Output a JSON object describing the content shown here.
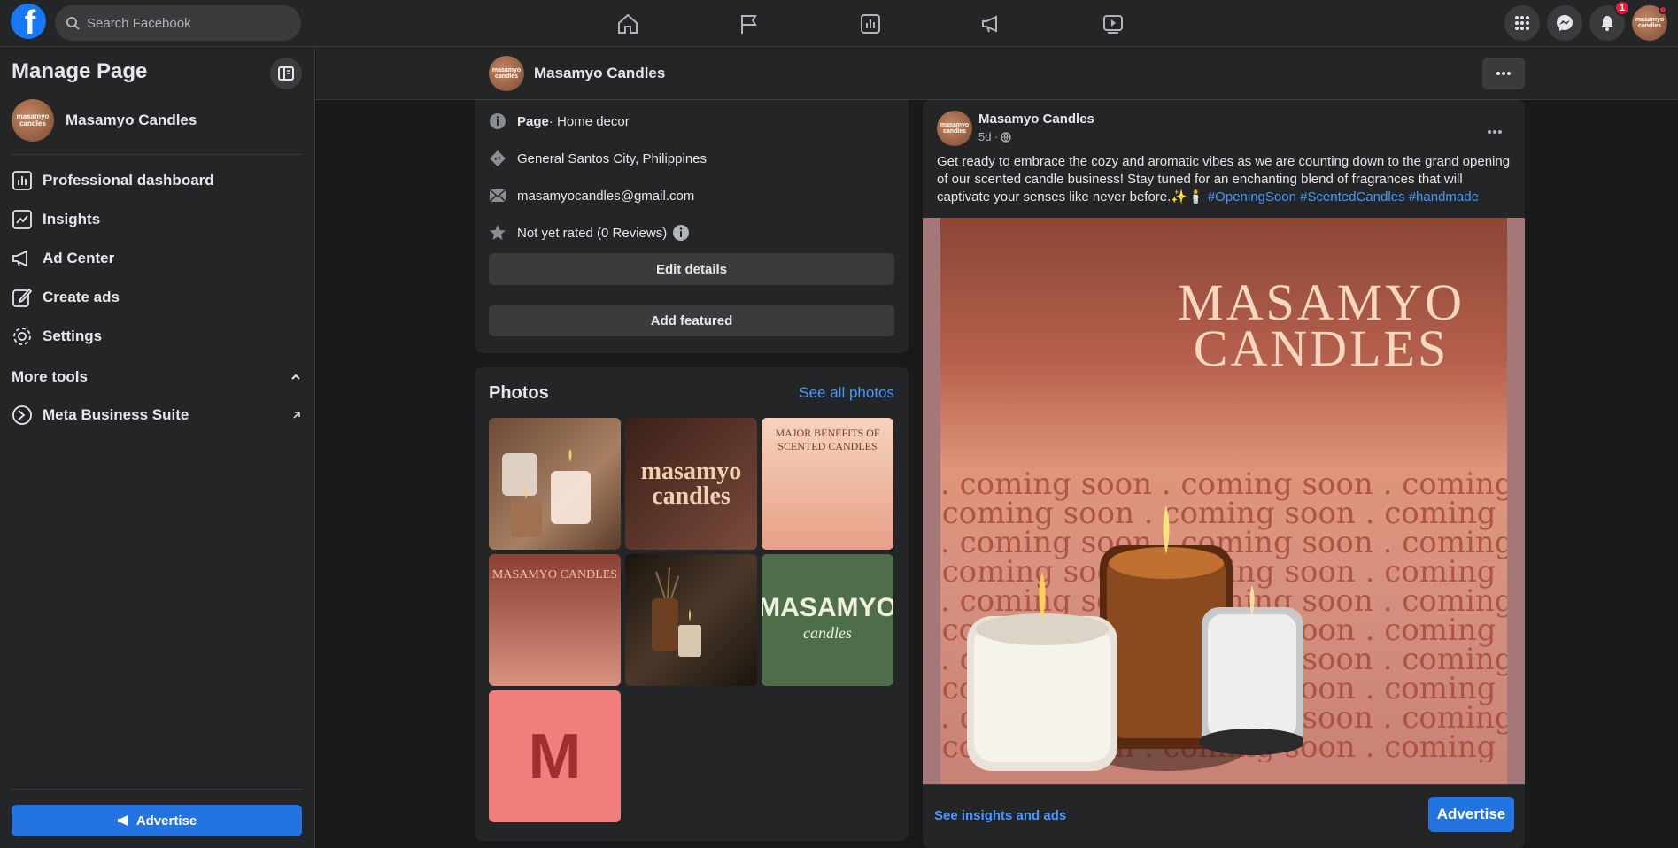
{
  "topbar": {
    "logo_letter": "f",
    "search_placeholder": "Search Facebook",
    "notifications_count": "1"
  },
  "sidebar": {
    "title": "Manage Page",
    "page_name": "Masamyo Candles",
    "avatar_text": "masamyo candles",
    "items": [
      {
        "label": "Professional dashboard",
        "icon": "dashboard-icon"
      },
      {
        "label": "Insights",
        "icon": "insights-icon"
      },
      {
        "label": "Ad Center",
        "icon": "megaphone-icon"
      },
      {
        "label": "Create ads",
        "icon": "edit-icon"
      },
      {
        "label": "Settings",
        "icon": "gear-icon"
      }
    ],
    "more_tools": "More tools",
    "meta_business": "Meta Business Suite",
    "advertise": "Advertise"
  },
  "header": {
    "page_name": "Masamyo Candles",
    "avatar_text": "masamyo candles"
  },
  "intro": {
    "category_bold": "Page",
    "category_rest": " · Home decor",
    "location": "General Santos City, Philippines",
    "email": "masamyocandles@gmail.com",
    "rating": "Not yet rated (0 Reviews)",
    "edit_details": "Edit details",
    "add_featured": "Add featured"
  },
  "photos": {
    "title": "Photos",
    "see_all": "See all photos",
    "items": [
      {
        "text": ""
      },
      {
        "text": "masamyo candles"
      },
      {
        "text": "MAJOR BENEFITS OF SCENTED CANDLES"
      },
      {
        "text": "MASAMYO CANDLES"
      },
      {
        "text": ""
      },
      {
        "text": "MASAMYO",
        "sub": "candles"
      },
      {
        "text": "M"
      }
    ]
  },
  "post": {
    "author": "Masamyo Candles",
    "time": "5d ·",
    "text": "Get ready to embrace the cozy and aromatic vibes as we are counting down to the grand opening of our scented candle business! Stay tuned for an enchanting blend of fragrances that will captivate your senses like never before.✨🕯️ ",
    "hashtags": [
      "#OpeningSoon",
      "#ScentedCandles",
      "#handmade"
    ],
    "image_title_1": "MASAMYO",
    "image_title_2": "CANDLES",
    "coming_soon": ". coming soon . coming soon . coming soon . coming",
    "insights_link": "See insights and ads",
    "advertise": "Advertise"
  },
  "colors": {
    "accent": "#2374e1",
    "link": "#4599ff",
    "surface": "#242526",
    "background": "#18191a"
  }
}
